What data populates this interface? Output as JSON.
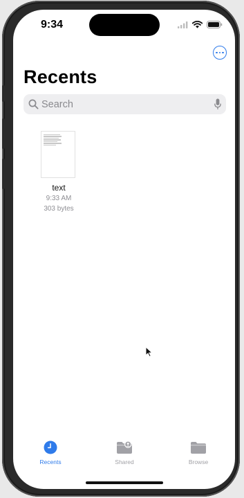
{
  "status_bar": {
    "time": "9:34",
    "icons": [
      "cellular-signal-icon",
      "wifi-icon",
      "battery-icon"
    ]
  },
  "nav": {
    "more_icon": "ellipsis-circle-icon"
  },
  "page": {
    "title": "Recents"
  },
  "search": {
    "placeholder": "Search",
    "value": "",
    "icons": [
      "search-icon",
      "microphone-icon"
    ]
  },
  "files": [
    {
      "name": "text",
      "time": "9:33 AM",
      "size": "303 bytes",
      "icon": "text-document-thumbnail"
    }
  ],
  "tabbar": {
    "tabs": [
      {
        "label": "Recents",
        "icon": "clock-icon",
        "active": true
      },
      {
        "label": "Shared",
        "icon": "shared-folder-icon",
        "active": false
      },
      {
        "label": "Browse",
        "icon": "folder-icon",
        "active": false
      }
    ]
  },
  "colors": {
    "accent": "#2f7bea",
    "inactive": "#a1a1a6",
    "search_bg": "#eeeef0"
  }
}
